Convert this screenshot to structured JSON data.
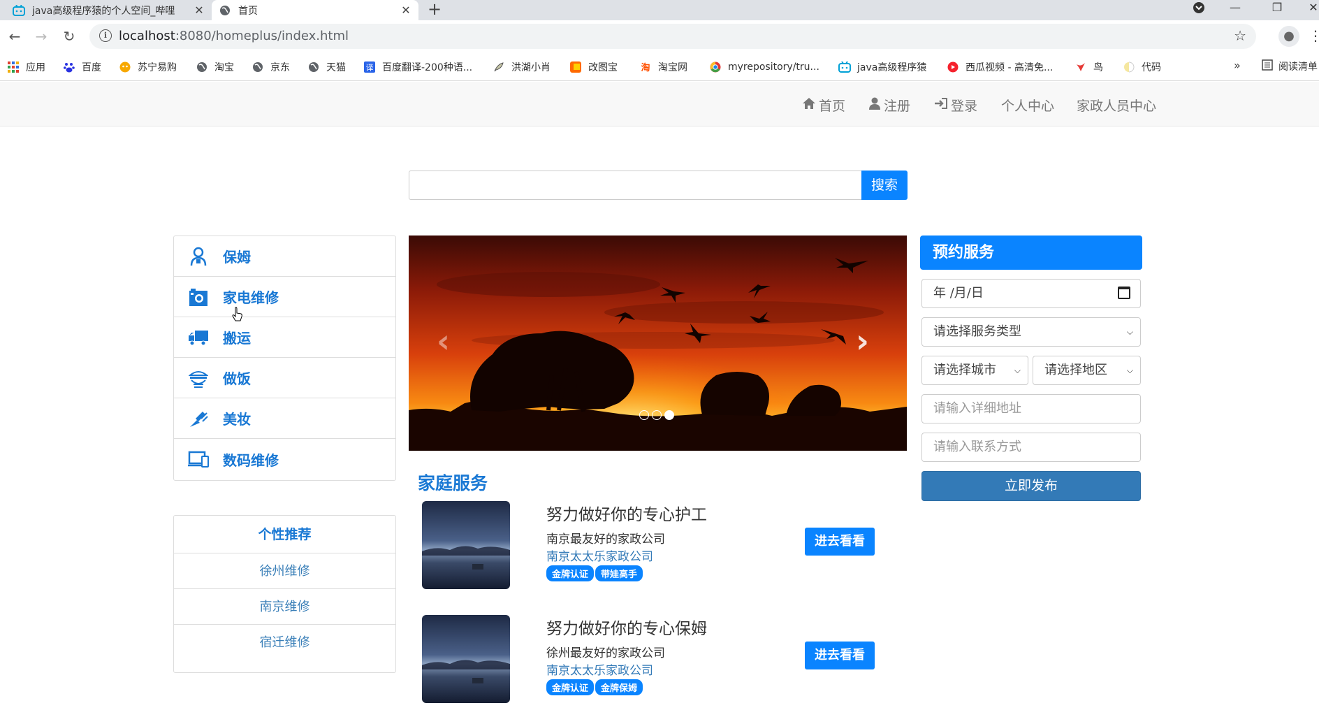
{
  "browser": {
    "tabs": [
      {
        "title": "java高级程序猿的个人空间_哔哩",
        "active": false
      },
      {
        "title": "首页",
        "active": true
      }
    ],
    "url_host": "localhost",
    "url_rest": ":8080/homeplus/index.html",
    "bookmarks": [
      {
        "label": "应用",
        "icon": "apps-grid-icon"
      },
      {
        "label": "百度",
        "icon": "baidu-paw-icon"
      },
      {
        "label": "苏宁易购",
        "icon": "suning-icon"
      },
      {
        "label": "淘宝",
        "icon": "globe-icon"
      },
      {
        "label": "京东",
        "icon": "globe-icon"
      },
      {
        "label": "天猫",
        "icon": "globe-icon"
      },
      {
        "label": "百度翻译-200种语...",
        "icon": "translate-icon"
      },
      {
        "label": "洪湖小肖",
        "icon": "feather-icon"
      },
      {
        "label": "改图宝",
        "icon": "photo-icon"
      },
      {
        "label": "淘宝网",
        "icon": "taobao-icon"
      },
      {
        "label": "myrepository/tru...",
        "icon": "chrome-icon"
      },
      {
        "label": "java高级程序猿",
        "icon": "bilibili-icon"
      },
      {
        "label": "西瓜视频 - 高清免...",
        "icon": "xigua-icon"
      },
      {
        "label": "鸟",
        "icon": "bird-icon"
      },
      {
        "label": "代码",
        "icon": "code-icon"
      }
    ],
    "bookmarks_more": "»",
    "reader_mode": "阅读清单"
  },
  "nav": {
    "home": "首页",
    "register": "注册",
    "login": "登录",
    "personal_center": "个人中心",
    "staff_center": "家政人员中心"
  },
  "search": {
    "placeholder": "",
    "button": "搜索"
  },
  "categories": [
    {
      "label": "保姆",
      "icon": "nanny-icon"
    },
    {
      "label": "家电维修",
      "icon": "appliance-repair-icon"
    },
    {
      "label": "搬运",
      "icon": "moving-truck-icon"
    },
    {
      "label": "做饭",
      "icon": "cooking-icon"
    },
    {
      "label": "美妆",
      "icon": "makeup-icon"
    },
    {
      "label": "数码维修",
      "icon": "digital-repair-icon"
    }
  ],
  "recommend": {
    "title": "个性推荐",
    "items": [
      "徐州维修",
      "南京维修",
      "宿迁维修"
    ]
  },
  "carousel": {
    "prev": "‹",
    "next": "›",
    "slide_count": 3,
    "active_slide": 3
  },
  "services": {
    "title": "家庭服务",
    "items": [
      {
        "title": "努力做好你的专心护工",
        "company": "南京最友好的家政公司",
        "link": "南京太太乐家政公司",
        "badges": [
          "金牌认证",
          "带娃高手"
        ],
        "button": "进去看看"
      },
      {
        "title": "努力做好你的专心保姆",
        "company": "徐州最友好的家政公司",
        "link": "南京太太乐家政公司",
        "badges": [
          "金牌认证",
          "金牌保姆"
        ],
        "button": "进去看看"
      }
    ]
  },
  "booking": {
    "title": "预约服务",
    "date_placeholder": "年 /月/日",
    "service_type": "请选择服务类型",
    "city": "请选择城市",
    "area": "请选择地区",
    "address_placeholder": "请输入详细地址",
    "contact_placeholder": "请输入联系方式",
    "submit": "立即发布"
  },
  "colors": {
    "primary": "#0a84ff",
    "category_text": "#1978d4",
    "publish": "#337ab7",
    "link": "#337ab7"
  }
}
